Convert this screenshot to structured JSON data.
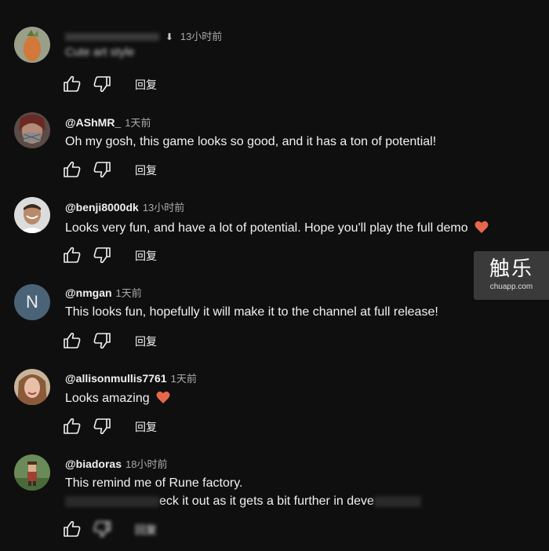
{
  "reply_label": "回复",
  "comments": [
    {
      "author": "",
      "time": "13小时前",
      "text": "Cute art style",
      "heart": false
    },
    {
      "author": "@AShMR_",
      "time": "1天前",
      "text": "Oh my gosh, this game looks so good, and it has a ton of potential!",
      "heart": false
    },
    {
      "author": "@benji8000dk",
      "time": "13小时前",
      "text": "Looks very fun, and have a lot of potential. Hope you'll play the full demo",
      "heart": true
    },
    {
      "author": "@nmgan",
      "time": "1天前",
      "avatar_letter": "N",
      "text": "This looks fun, hopefully it will make it to the channel at full release!",
      "heart": false
    },
    {
      "author": "@allisonmullis7761",
      "time": "1天前",
      "text": "Looks amazing",
      "heart": true
    },
    {
      "author": "@biadoras",
      "time": "18小时前",
      "text": "This remind me of Rune factory.",
      "text2": "eck it out as it gets a bit further in deve",
      "heart": false
    }
  ],
  "watermark": {
    "title": "触乐",
    "url": "chuapp.com"
  },
  "colors": {
    "background": "#0f0f0f",
    "heart": "#e8674a",
    "avatar_letter_bg": "#4a6376"
  }
}
